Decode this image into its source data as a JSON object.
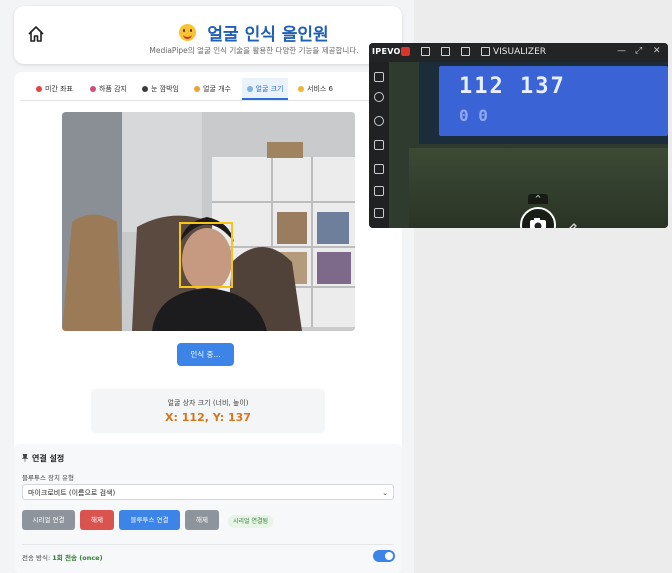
{
  "app": {
    "title": "얼굴 인식 올인원",
    "subtitle": "MediaPipe의 얼굴 인식 기술을 활용한 다양한 기능을 제공합니다.",
    "tabs": [
      {
        "label": "미간 좌표",
        "active": false
      },
      {
        "label": "하품 감지",
        "active": false
      },
      {
        "label": "눈 깜박임",
        "active": false
      },
      {
        "label": "얼굴 개수",
        "active": false
      },
      {
        "label": "얼굴 크기",
        "active": true
      },
      {
        "label": "서비스 6",
        "active": false
      }
    ],
    "recognize_button": "인식 중...",
    "face_size": {
      "label": "얼굴 상자 크기 (너비, 높이)",
      "value": "X: 112, Y: 137"
    },
    "connection": {
      "title": "연결 설정",
      "device_type_label": "블루투스 장치 유형",
      "device_selected": "마이크로비트 (이름으로 검색)",
      "buttons": {
        "serial_connect": "시리얼 연결",
        "serial_disconnect": "해제",
        "bt_connect": "블루투스 연결",
        "bt_disconnect": "해제"
      },
      "status_badge": "시리얼 연결됨",
      "transmit_mode_label": "전송 방식:",
      "transmit_mode_value": "1회 전송 (once)",
      "toggle_on": true
    }
  },
  "ipevo": {
    "logo": "IPEVO",
    "title": "VISUALIZER",
    "lcd_line1": "112   137",
    "lcd_line2": "0       0"
  },
  "colors": {
    "primary": "#3d84e8",
    "danger": "#d9534f",
    "neutral": "#8e949b",
    "accent_value": "#d4771a",
    "face_box": "#f5c518"
  }
}
